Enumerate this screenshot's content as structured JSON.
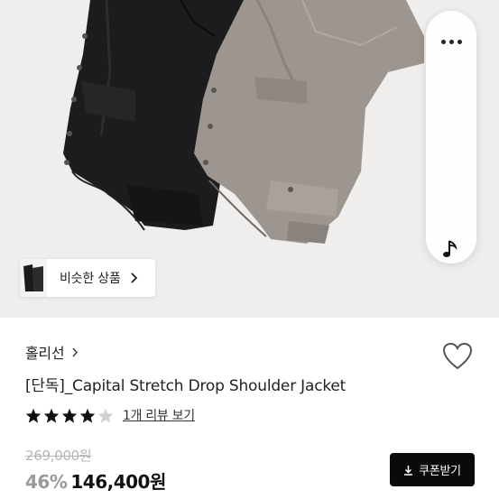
{
  "product_image": {
    "alt": "",
    "background": "#efeeec"
  },
  "side_actions": {
    "more_icon": "more-dots-icon",
    "music_icon": "music-note-icon"
  },
  "similar_products": {
    "label": "비슷한 상품"
  },
  "brand": {
    "name": "홀리선"
  },
  "product": {
    "title": "[단독]_Capital Stretch Drop Shoulder Jacket"
  },
  "rating": {
    "stars": 4,
    "max": 5,
    "review_label": "1개 리뷰 보기"
  },
  "price": {
    "original": "269,000원",
    "discount": "46%",
    "sale": "146,400원"
  },
  "coupon_button": {
    "label": "쿠폰받기"
  },
  "colors": {
    "accent": "#0a0a0a",
    "discount": "#9a9a9a",
    "muted": "#b5b5b5"
  }
}
